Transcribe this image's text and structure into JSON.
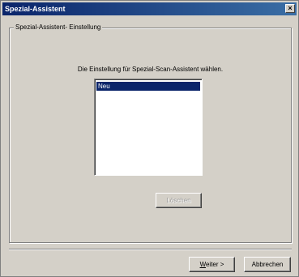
{
  "window": {
    "title": "Spezial-Assistent",
    "close_glyph": "×"
  },
  "group": {
    "label": "Spezial-Assistent- Einstellung"
  },
  "instruction": "Die Einstellung für Spezial-Scan-Assistent wählen.",
  "list": {
    "items": [
      "Neu"
    ],
    "selected_index": 0
  },
  "buttons": {
    "delete": "Löschen",
    "next_prefix": "W",
    "next_rest": "eiter >",
    "cancel": "Abbrechen"
  },
  "colors": {
    "title_bar": "#0a246a",
    "selection": "#0a246a",
    "face": "#d4d0c8"
  }
}
